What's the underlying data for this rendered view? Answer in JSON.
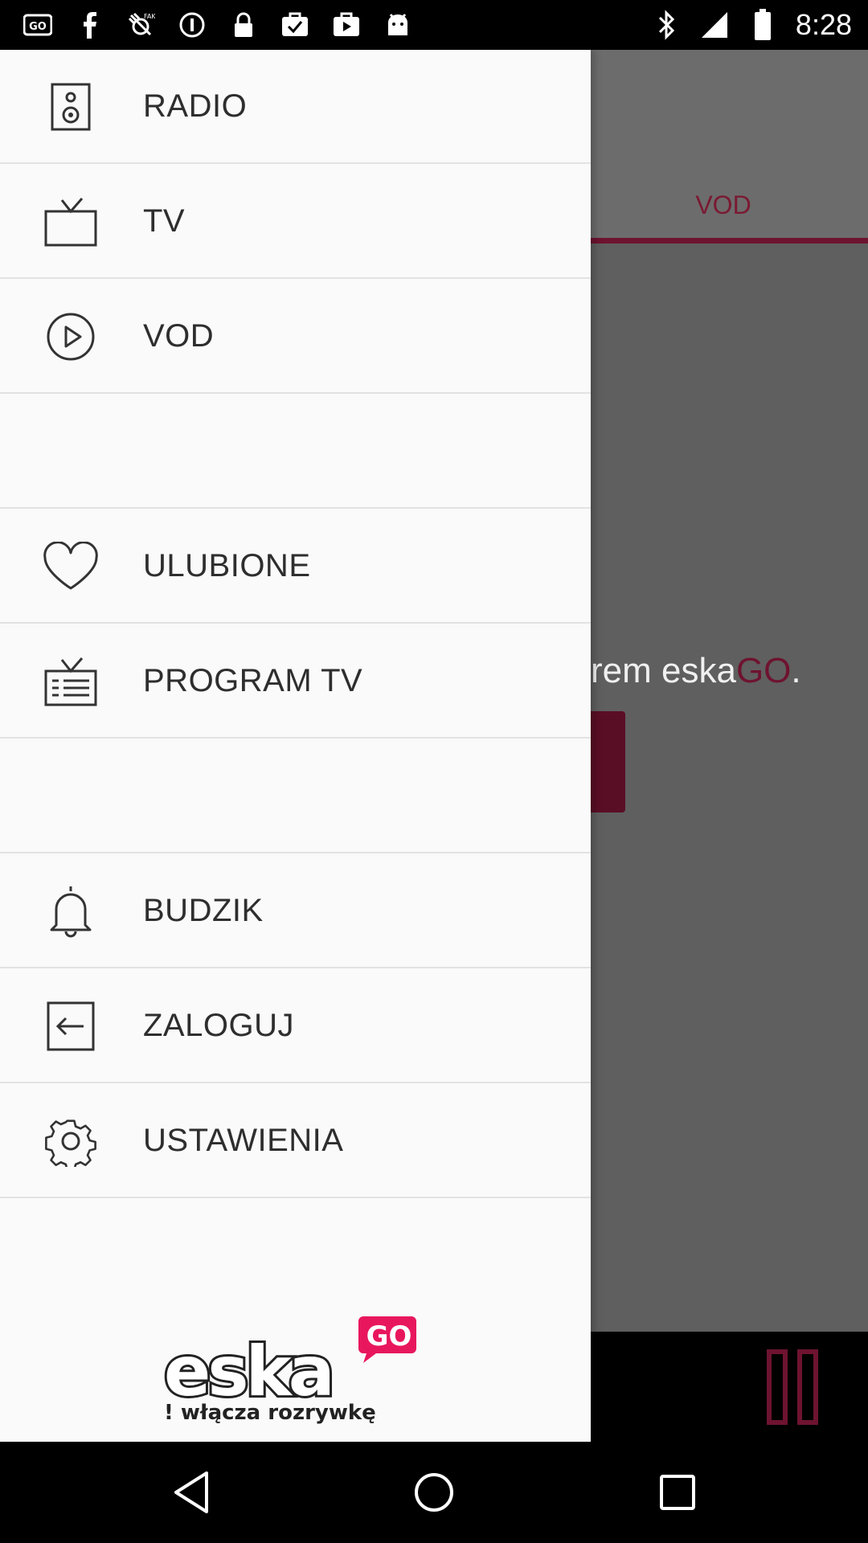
{
  "status_bar": {
    "time": "8:28",
    "left_icons": [
      "go-app-icon",
      "facebook-icon",
      "fake-gps-icon",
      "info-icon",
      "lock-icon",
      "task-check-icon",
      "youtube-icon",
      "android-icon"
    ],
    "right_icons": [
      "bluetooth-icon",
      "signal-icon",
      "battery-icon"
    ]
  },
  "background_app": {
    "tab_label": "VOD",
    "message_prefix": "rem eska",
    "message_brand": "GO",
    "message_suffix": ".",
    "accent_color": "#6e1330"
  },
  "drawer": {
    "items": [
      {
        "label": "RADIO",
        "icon": "speaker-icon"
      },
      {
        "label": "TV",
        "icon": "tv-icon"
      },
      {
        "label": "VOD",
        "icon": "play-circle-icon"
      },
      {
        "label": "ULUBIONE",
        "icon": "heart-icon"
      },
      {
        "label": "PROGRAM TV",
        "icon": "tv-guide-icon"
      },
      {
        "label": "BUDZIK",
        "icon": "bell-icon"
      },
      {
        "label": "ZALOGUJ",
        "icon": "login-icon"
      },
      {
        "label": "USTAWIENIA",
        "icon": "gear-icon"
      }
    ],
    "logo": {
      "brand": "eska",
      "badge": "GO",
      "tagline": "! włącza rozrywkę",
      "badge_color": "#e8175d"
    }
  },
  "nav_bar": {
    "buttons": [
      "back-icon",
      "home-icon",
      "recents-icon"
    ]
  }
}
